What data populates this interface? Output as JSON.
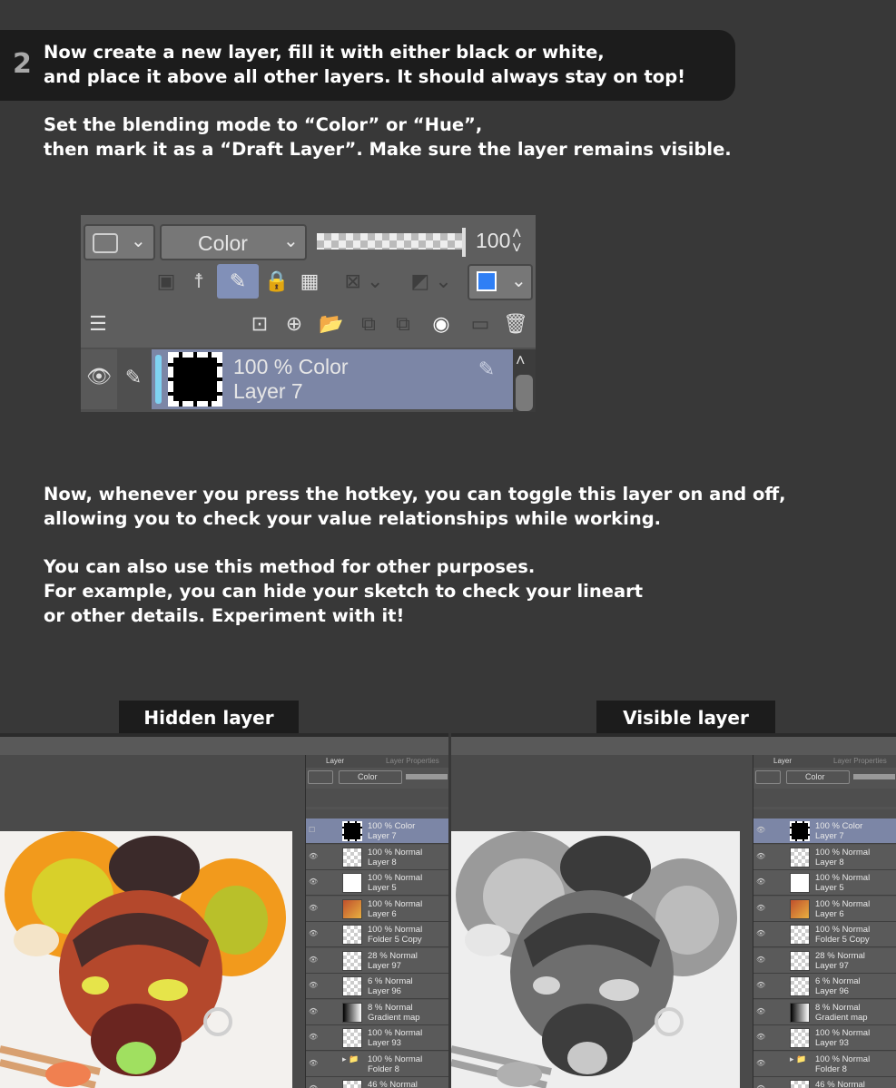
{
  "step": {
    "number": "2",
    "line1": "Now create a new layer, fill it with either black or white,",
    "line2": "and place it above all other layers. It should always stay on top!"
  },
  "instructions": {
    "line1": "Set the blending mode to “Color” or “Hue”,",
    "line2": "then mark it as a “Draft Layer”. Make sure the layer remains visible."
  },
  "layer_panel": {
    "blend_mode": "Color",
    "opacity": "100",
    "layer_opacity_mode": "100 % Color",
    "layer_name": "Layer 7"
  },
  "body_text": {
    "p1_line1": "Now, whenever you press the hotkey, you can toggle this layer on and off,",
    "p1_line2": "allowing you to check your value relationships while working.",
    "p2_line1": "You can also use this method for other purposes.",
    "p2_line2": "For example, you can hide your sketch to check your lineart",
    "p2_line3": "or other details. Experiment with it!"
  },
  "labels": {
    "hidden": "Hidden layer",
    "visible": "Visible layer"
  },
  "small_panel": {
    "tab_layer": "Layer",
    "tab_properties": "Layer Properties",
    "blend_mode": "Color",
    "layers": [
      {
        "mode": "100 % Color",
        "name": "Layer 7",
        "thumb": "black"
      },
      {
        "mode": "100 % Normal",
        "name": "Layer 8",
        "thumb": "checker"
      },
      {
        "mode": "100 % Normal",
        "name": "Layer 5",
        "thumb": "white"
      },
      {
        "mode": "100 % Normal",
        "name": "Layer 6",
        "thumb": "art"
      },
      {
        "mode": "100 % Normal",
        "name": "Folder 5 Copy",
        "thumb": "checker"
      },
      {
        "mode": "28 % Normal",
        "name": "Layer 97",
        "thumb": "checker"
      },
      {
        "mode": "6 % Normal",
        "name": "Layer 96",
        "thumb": "checker"
      },
      {
        "mode": "8 % Normal",
        "name": "Gradient map",
        "thumb": "gradient"
      },
      {
        "mode": "100 % Normal",
        "name": "Layer 93",
        "thumb": "checker"
      },
      {
        "mode": "100 % Normal",
        "name": "Folder 8",
        "thumb": "folder"
      },
      {
        "mode": "46 % Normal",
        "name": "",
        "thumb": "checker"
      }
    ]
  },
  "colors": {
    "background": "#383838",
    "banner": "#1c1c1c",
    "selection": "#7c86a6",
    "active_bar": "#7fd2f2"
  }
}
